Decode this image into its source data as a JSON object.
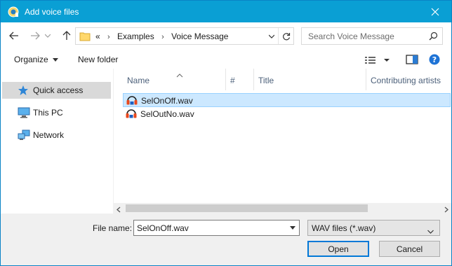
{
  "window": {
    "title": "Add voice files"
  },
  "address": {
    "overflow": "«",
    "crumbs": [
      "Examples",
      "Voice Message"
    ]
  },
  "search": {
    "placeholder": "Search Voice Message"
  },
  "toolbar": {
    "organize": "Organize",
    "new_folder": "New folder"
  },
  "nav": {
    "items": [
      {
        "label": "Quick access",
        "icon": "star-icon",
        "selected": true
      },
      {
        "label": "This PC",
        "icon": "computer-icon",
        "selected": false
      },
      {
        "label": "Network",
        "icon": "network-icon",
        "selected": false
      }
    ]
  },
  "columns": [
    "Name",
    "#",
    "Title",
    "Contributing artists"
  ],
  "files": [
    {
      "name": "SelOnOff.wav",
      "selected": true,
      "icon": "audio-file-icon"
    },
    {
      "name": "SelOutNo.wav",
      "selected": false,
      "icon": "audio-file-icon"
    }
  ],
  "bottom": {
    "file_name_label": "File name:",
    "file_name_value": "SelOnOff.wav",
    "file_type": "WAV files (*.wav)",
    "open_label": "Open",
    "cancel_label": "Cancel"
  },
  "colors": {
    "titlebar": "#0a9fd4",
    "selection": "#cce8ff",
    "nav_selection": "#d9d9d9",
    "accent": "#0078d7"
  }
}
